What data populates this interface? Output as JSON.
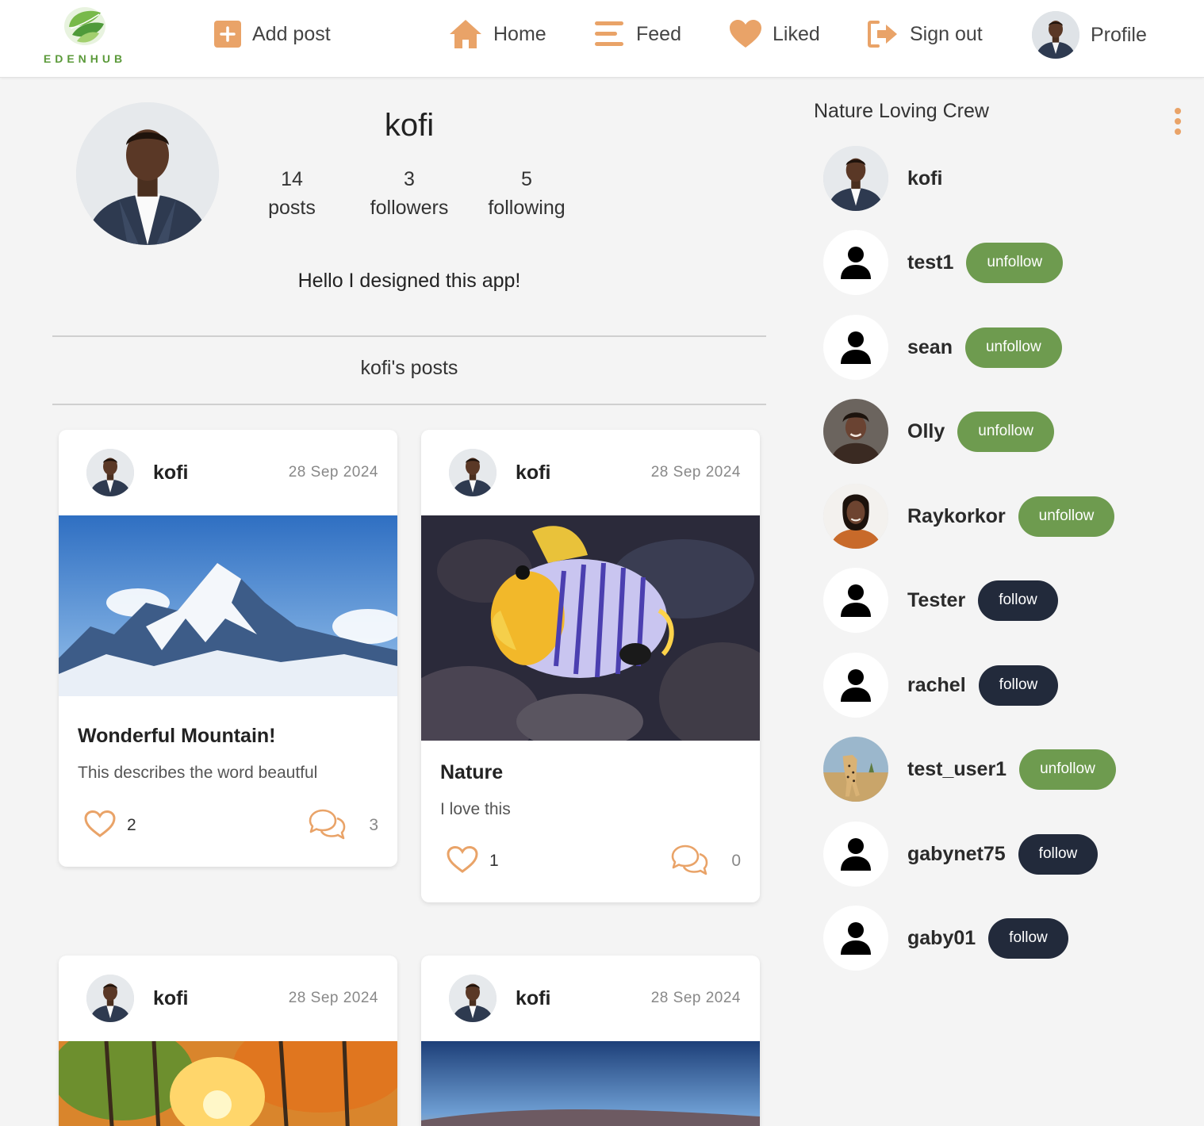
{
  "brand": {
    "name": "EDENHUB",
    "accent": "#e9a368",
    "green": "#6e9b4f",
    "navy": "#222a3b"
  },
  "nav": {
    "add_post": "Add post",
    "home": "Home",
    "feed": "Feed",
    "liked": "Liked",
    "sign_out": "Sign out",
    "profile": "Profile"
  },
  "profile": {
    "username": "kofi",
    "stats": {
      "posts_count": "14",
      "posts_label": "posts",
      "followers_count": "3",
      "followers_label": "followers",
      "following_count": "5",
      "following_label": "following"
    },
    "bio": "Hello I designed this app!",
    "posts_heading": "kofi's posts"
  },
  "posts": [
    {
      "author": "kofi",
      "date": "28 Sep 2024",
      "image": "snowy-mountain-photo",
      "title": "Wonderful Mountain!",
      "description": "This describes the word beautful",
      "likes": "2",
      "comments": "3"
    },
    {
      "author": "kofi",
      "date": "28 Sep 2024",
      "image": "tropical-fish-photo",
      "title": "Nature",
      "description": "I love this",
      "likes": "1",
      "comments": "0"
    },
    {
      "author": "kofi",
      "date": "28 Sep 2024",
      "image": "autumn-forest-photo"
    },
    {
      "author": "kofi",
      "date": "28 Sep 2024",
      "image": "sunset-landscape-photo"
    }
  ],
  "crew": {
    "title": "Nature Loving Crew",
    "members": [
      {
        "name": "kofi",
        "avatar": "photo"
      },
      {
        "name": "test1",
        "avatar": "default",
        "button": "unfollow"
      },
      {
        "name": "sean",
        "avatar": "default",
        "button": "unfollow"
      },
      {
        "name": "Olly",
        "avatar": "photo",
        "button": "unfollow"
      },
      {
        "name": "Raykorkor",
        "avatar": "photo",
        "button": "unfollow"
      },
      {
        "name": "Tester",
        "avatar": "default",
        "button": "follow"
      },
      {
        "name": "rachel",
        "avatar": "default",
        "button": "follow"
      },
      {
        "name": "test_user1",
        "avatar": "cheetah-photo",
        "button": "unfollow"
      },
      {
        "name": "gabynet75",
        "avatar": "default",
        "button": "follow"
      },
      {
        "name": "gaby01",
        "avatar": "default",
        "button": "follow"
      }
    ]
  },
  "icons": [
    "plus-square-icon",
    "home-icon",
    "feed-lines-icon",
    "heart-icon",
    "sign-out-icon",
    "kebab-menu-icon",
    "heart-outline-icon",
    "comments-icon",
    "person-icon"
  ]
}
